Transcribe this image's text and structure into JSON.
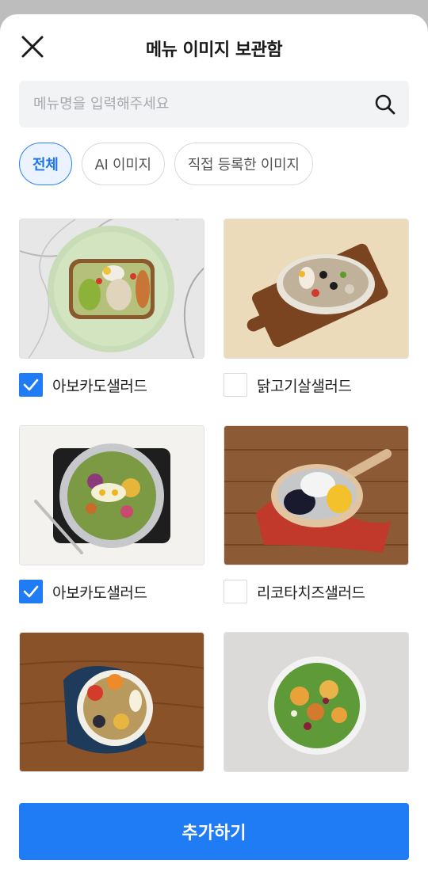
{
  "header": {
    "title": "메뉴 이미지 보관함",
    "close_icon": "close-icon"
  },
  "search": {
    "placeholder": "메뉴명을 입력해주세요",
    "value": "",
    "icon": "search-icon"
  },
  "tabs": [
    {
      "label": "전체",
      "active": true
    },
    {
      "label": "AI 이미지",
      "active": false
    },
    {
      "label": "직접 등록한 이미지",
      "active": false
    }
  ],
  "items": [
    {
      "label": "아보카도샐러드",
      "checked": true
    },
    {
      "label": "닭고기살샐러드",
      "checked": false
    },
    {
      "label": "아보카도샐러드",
      "checked": true
    },
    {
      "label": "리코타치즈샐러드",
      "checked": false
    },
    {
      "label": "",
      "checked": false
    },
    {
      "label": "",
      "checked": false
    }
  ],
  "footer": {
    "add_label": "추가하기"
  },
  "colors": {
    "accent": "#1f7cf4",
    "tab_active_bg": "#eaf3ff",
    "search_bg": "#f2f3f5"
  }
}
